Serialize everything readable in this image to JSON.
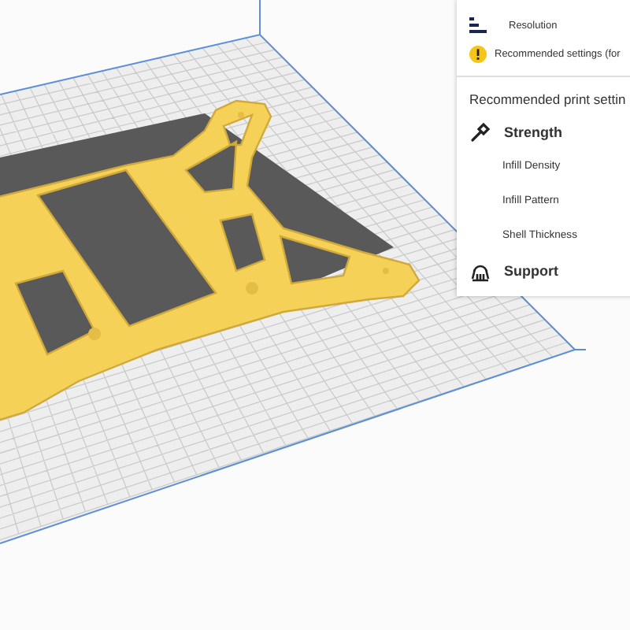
{
  "settings_panel": {
    "resolution": {
      "label": "Resolution"
    },
    "notice": {
      "text": "Recommended settings (for"
    },
    "heading": "Recommended print settin",
    "sections": [
      {
        "kind": "strength",
        "title": "Strength",
        "items": [
          "Infill Density",
          "Infill Pattern",
          "Shell Thickness"
        ]
      },
      {
        "kind": "support",
        "title": "Support"
      }
    ]
  }
}
